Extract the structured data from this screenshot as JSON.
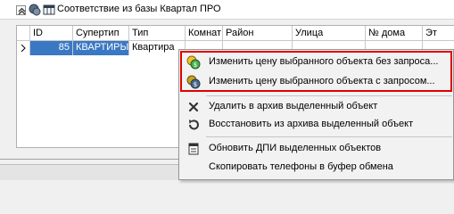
{
  "window": {
    "title": "Соответствие из базы Квартал ПРО"
  },
  "grid": {
    "columns": [
      "ID",
      "Супертип",
      "Тип",
      "Комнат",
      "Район",
      "Улица",
      "№ дома",
      "Эт"
    ],
    "rows": [
      {
        "id": "85",
        "supertype": "КВАРТИРЫ",
        "type": "Квартира",
        "rooms": "",
        "district": "",
        "street": "",
        "house": "",
        "floor": ""
      }
    ]
  },
  "context_menu": {
    "items": [
      {
        "label": "Изменить цену выбранного объекта без запроса...",
        "icon": "coin-green-icon"
      },
      {
        "label": "Изменить цену выбранного объекта с запросом...",
        "icon": "coin-blue-icon"
      },
      {
        "label": "Удалить в архив выделенный объект",
        "icon": "x-icon"
      },
      {
        "label": "Восстановить из архива выделенный объект",
        "icon": "restore-icon"
      },
      {
        "label": "Обновить ДПИ выделенных объектов",
        "icon": "document-icon"
      },
      {
        "label": "Скопировать телефоны в буфер обмена",
        "icon": ""
      }
    ]
  },
  "colors": {
    "selection": "#3a78c4",
    "highlight_box": "#e00000",
    "menu_bg": "#f2f2f2"
  }
}
